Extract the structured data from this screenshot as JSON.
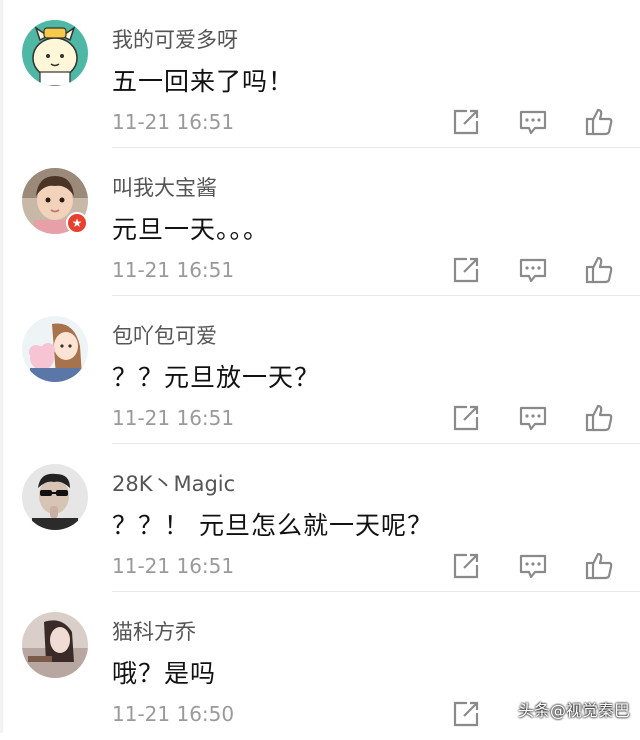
{
  "comments": [
    {
      "username": "我的可爱多呀",
      "content": "五一回来了吗！",
      "time": "11-21 16:51",
      "avatar": "cartoon-avatar"
    },
    {
      "username": "叫我大宝酱",
      "content": "元旦一天。。。",
      "time": "11-21 16:51",
      "avatar": "child-photo-avatar",
      "badge": "vip-badge-icon"
    },
    {
      "username": "包吖包可爱",
      "content": "？？元旦放一天？",
      "time": "11-21 16:51",
      "avatar": "illustrated-girl-avatar"
    },
    {
      "username": "28K丶Magic",
      "content": "？？！ 元旦怎么就一天呢？",
      "time": "11-21 16:51",
      "avatar": "sunglasses-man-avatar"
    },
    {
      "username": "猫科方乔",
      "content": "哦？是吗",
      "time": "11-21 16:50",
      "avatar": "portrait-photo-avatar"
    }
  ],
  "icons": {
    "share": "share-icon",
    "reply": "comment-icon",
    "like": "thumbs-up-icon"
  },
  "watermark": "头条@视觉秦巴",
  "colors": {
    "icon": "#8a8a8a",
    "time": "#9a9a9a",
    "username": "#555555",
    "badge": "#e8402f"
  }
}
